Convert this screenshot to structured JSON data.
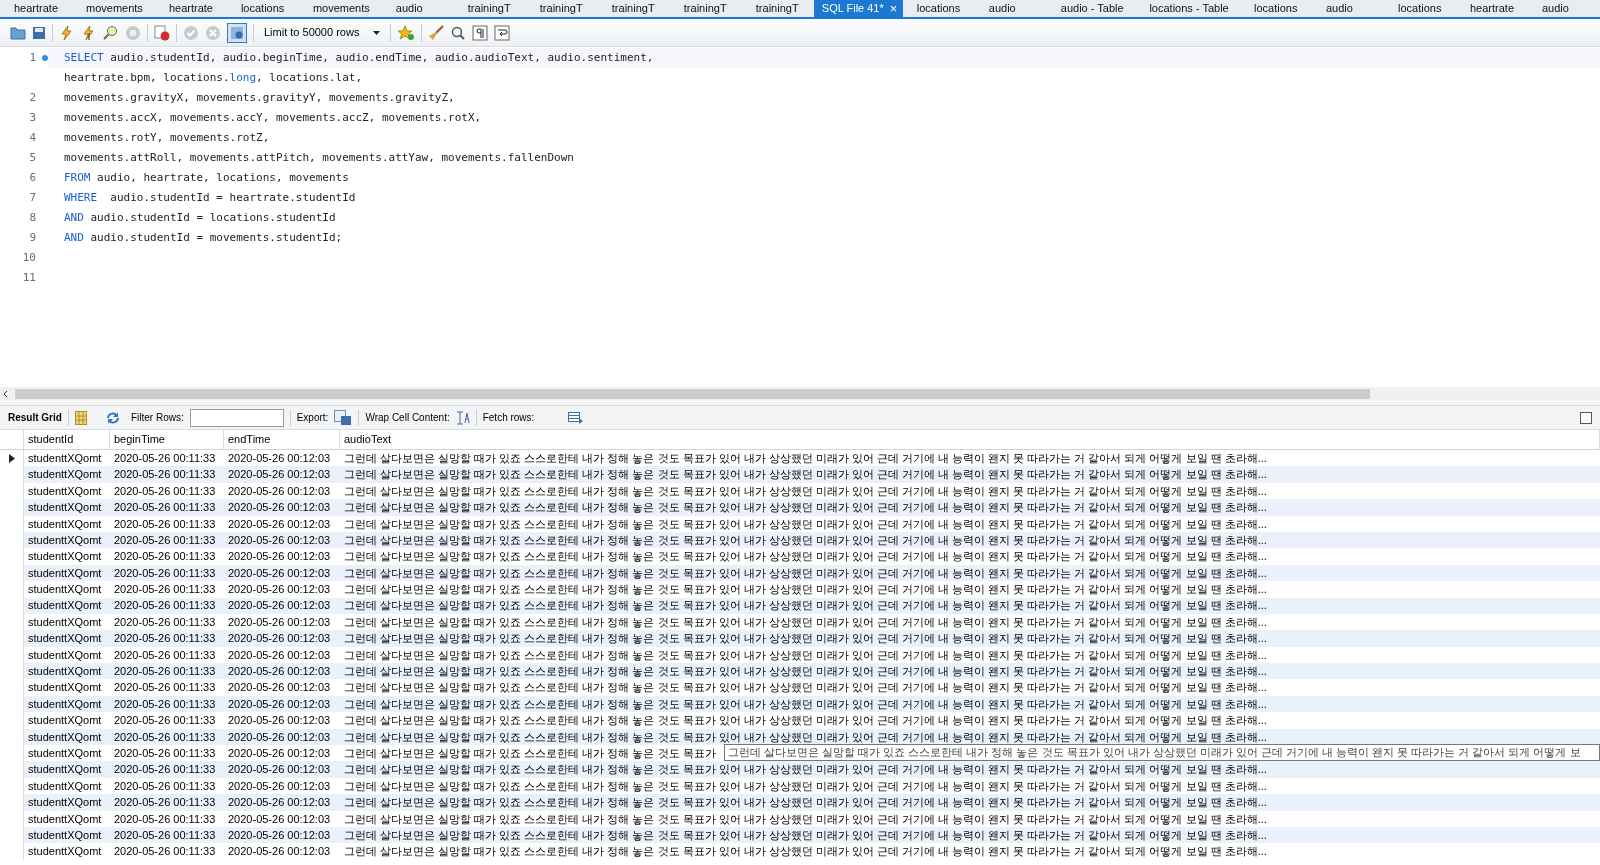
{
  "tabs": [
    {
      "label": "heartrate",
      "selected": false
    },
    {
      "label": "movements",
      "selected": false
    },
    {
      "label": "heartrate",
      "selected": false
    },
    {
      "label": "locations",
      "selected": false
    },
    {
      "label": "movements",
      "selected": false
    },
    {
      "label": "audio",
      "selected": false
    },
    {
      "label": "trainingT",
      "selected": false
    },
    {
      "label": "trainingT",
      "selected": false
    },
    {
      "label": "trainingT",
      "selected": false
    },
    {
      "label": "trainingT",
      "selected": false
    },
    {
      "label": "trainingT",
      "selected": false
    },
    {
      "label": "SQL File 41*",
      "selected": true,
      "close": "×"
    },
    {
      "label": "locations",
      "selected": false
    },
    {
      "label": "audio",
      "selected": false
    },
    {
      "label": "audio - Table",
      "selected": false
    },
    {
      "label": "locations - Table",
      "selected": false
    },
    {
      "label": "locations",
      "selected": false
    },
    {
      "label": "audio",
      "selected": false
    },
    {
      "label": "locations",
      "selected": false
    },
    {
      "label": "heartrate",
      "selected": false
    },
    {
      "label": "audio",
      "selected": false
    }
  ],
  "toolbar": {
    "limit": "Limit to 50000 rows"
  },
  "editor": {
    "lines": [
      {
        "number": "1",
        "marker": true,
        "segments": [
          {
            "kind": "keyword",
            "text": "SELECT"
          },
          {
            "kind": "plain",
            "text": " audio.studentId, audio.beginTime, audio.endTime, audio.audioText, audio.sentiment,"
          }
        ]
      },
      {
        "marker": false,
        "segments": [
          {
            "kind": "plain",
            "text": "heartrate.bpm, locations."
          },
          {
            "kind": "keyword",
            "text": "long"
          },
          {
            "kind": "plain",
            "text": ", locations.lat,"
          }
        ]
      },
      {
        "number": "2",
        "marker": false,
        "segments": [
          {
            "kind": "plain",
            "text": "movements.gravityX, movements.gravityY, movements.gravityZ,"
          }
        ]
      },
      {
        "number": "3",
        "marker": false,
        "segments": [
          {
            "kind": "plain",
            "text": "movements.accX, movements.accY, movements.accZ, movements.rotX,"
          }
        ]
      },
      {
        "number": "4",
        "marker": false,
        "segments": [
          {
            "kind": "plain",
            "text": "movements.rotY, movements.rotZ,"
          }
        ]
      },
      {
        "number": "5",
        "marker": false,
        "segments": [
          {
            "kind": "plain",
            "text": "movements.attRoll, movements.attPitch, movements.attYaw, movements.fallenDown"
          }
        ]
      },
      {
        "number": "6",
        "marker": false,
        "segments": [
          {
            "kind": "keyword",
            "text": "FROM"
          },
          {
            "kind": "plain",
            "text": " audio, heartrate, locations, movements"
          }
        ]
      },
      {
        "number": "7",
        "marker": false,
        "segments": [
          {
            "kind": "keyword",
            "text": "WHERE"
          },
          {
            "kind": "plain",
            "text": "  audio.studentId = heartrate.studentId"
          }
        ]
      },
      {
        "number": "8",
        "marker": false,
        "segments": [
          {
            "kind": "keyword",
            "text": "AND"
          },
          {
            "kind": "plain",
            "text": " audio.studentId = locations.studentId"
          }
        ]
      },
      {
        "number": "9",
        "marker": false,
        "segments": [
          {
            "kind": "keyword",
            "text": "AND"
          },
          {
            "kind": "plain",
            "text": " audio.studentId = movements.studentId;"
          }
        ]
      },
      {
        "number": "10",
        "marker": false
      },
      {
        "number": "11",
        "marker": false
      }
    ]
  },
  "result_toolbar": {
    "title": "Result Grid",
    "filter_label": "Filter Rows:",
    "export_label": "Export:",
    "wrap_label": "Wrap Cell Content:",
    "fetch_label": "Fetch rows:"
  },
  "table": {
    "columns": [
      "studentId",
      "beginTime",
      "endTime",
      "audioText"
    ],
    "rows": [
      {
        "selected": true,
        "cells": [
          "studenttXQomt",
          "2020-05-26 00:11:33",
          "2020-05-26 00:12:03",
          "그런데 살다보면은 실망할 때가 있죠 스스로한테 내가 정해 놓은 것도 목표가 있어 내가 상상했던 미래가 있어 근데 거기에 내 능력이 왠지 못 따라가는 거 같아서 되게 어떻게 보일 땐 초라해..."
        ]
      },
      {
        "selected": false,
        "cells": [
          "studenttXQomt",
          "2020-05-26 00:11:33",
          "2020-05-26 00:12:03",
          "그런데 살다보면은 실망할 때가 있죠 스스로한테 내가 정해 놓은 것도 목표가 있어 내가 상상했던 미래가 있어 근데 거기에 내 능력이 왠지 못 따라가는 거 같아서 되게 어떻게 보일 땐 초라해..."
        ]
      },
      {
        "selected": false,
        "cells": [
          "studenttXQomt",
          "2020-05-26 00:11:33",
          "2020-05-26 00:12:03",
          "그런데 살다보면은 실망할 때가 있죠 스스로한테 내가 정해 놓은 것도 목표가 있어 내가 상상했던 미래가 있어 근데 거기에 내 능력이 왠지 못 따라가는 거 같아서 되게 어떻게 보일 땐 초라해..."
        ]
      },
      {
        "selected": false,
        "cells": [
          "studenttXQomt",
          "2020-05-26 00:11:33",
          "2020-05-26 00:12:03",
          "그런데 살다보면은 실망할 때가 있죠 스스로한테 내가 정해 놓은 것도 목표가 있어 내가 상상했던 미래가 있어 근데 거기에 내 능력이 왠지 못 따라가는 거 같아서 되게 어떻게 보일 땐 초라해..."
        ]
      },
      {
        "selected": false,
        "cells": [
          "studenttXQomt",
          "2020-05-26 00:11:33",
          "2020-05-26 00:12:03",
          "그런데 살다보면은 실망할 때가 있죠 스스로한테 내가 정해 놓은 것도 목표가 있어 내가 상상했던 미래가 있어 근데 거기에 내 능력이 왠지 못 따라가는 거 같아서 되게 어떻게 보일 땐 초라해..."
        ]
      },
      {
        "selected": false,
        "cells": [
          "studenttXQomt",
          "2020-05-26 00:11:33",
          "2020-05-26 00:12:03",
          "그런데 살다보면은 실망할 때가 있죠 스스로한테 내가 정해 놓은 것도 목표가 있어 내가 상상했던 미래가 있어 근데 거기에 내 능력이 왠지 못 따라가는 거 같아서 되게 어떻게 보일 땐 초라해..."
        ]
      },
      {
        "selected": false,
        "cells": [
          "studenttXQomt",
          "2020-05-26 00:11:33",
          "2020-05-26 00:12:03",
          "그런데 살다보면은 실망할 때가 있죠 스스로한테 내가 정해 놓은 것도 목표가 있어 내가 상상했던 미래가 있어 근데 거기에 내 능력이 왠지 못 따라가는 거 같아서 되게 어떻게 보일 땐 초라해..."
        ]
      },
      {
        "selected": false,
        "cells": [
          "studenttXQomt",
          "2020-05-26 00:11:33",
          "2020-05-26 00:12:03",
          "그런데 살다보면은 실망할 때가 있죠 스스로한테 내가 정해 놓은 것도 목표가 있어 내가 상상했던 미래가 있어 근데 거기에 내 능력이 왠지 못 따라가는 거 같아서 되게 어떻게 보일 땐 초라해..."
        ]
      },
      {
        "selected": false,
        "cells": [
          "studenttXQomt",
          "2020-05-26 00:11:33",
          "2020-05-26 00:12:03",
          "그런데 살다보면은 실망할 때가 있죠 스스로한테 내가 정해 놓은 것도 목표가 있어 내가 상상했던 미래가 있어 근데 거기에 내 능력이 왠지 못 따라가는 거 같아서 되게 어떻게 보일 땐 초라해..."
        ]
      },
      {
        "selected": false,
        "cells": [
          "studenttXQomt",
          "2020-05-26 00:11:33",
          "2020-05-26 00:12:03",
          "그런데 살다보면은 실망할 때가 있죠 스스로한테 내가 정해 놓은 것도 목표가 있어 내가 상상했던 미래가 있어 근데 거기에 내 능력이 왠지 못 따라가는 거 같아서 되게 어떻게 보일 땐 초라해..."
        ]
      },
      {
        "selected": false,
        "cells": [
          "studenttXQomt",
          "2020-05-26 00:11:33",
          "2020-05-26 00:12:03",
          "그런데 살다보면은 실망할 때가 있죠 스스로한테 내가 정해 놓은 것도 목표가 있어 내가 상상했던 미래가 있어 근데 거기에 내 능력이 왠지 못 따라가는 거 같아서 되게 어떻게 보일 땐 초라해..."
        ]
      },
      {
        "selected": false,
        "cells": [
          "studenttXQomt",
          "2020-05-26 00:11:33",
          "2020-05-26 00:12:03",
          "그런데 살다보면은 실망할 때가 있죠 스스로한테 내가 정해 놓은 것도 목표가 있어 내가 상상했던 미래가 있어 근데 거기에 내 능력이 왠지 못 따라가는 거 같아서 되게 어떻게 보일 땐 초라해..."
        ]
      },
      {
        "selected": false,
        "cells": [
          "studenttXQomt",
          "2020-05-26 00:11:33",
          "2020-05-26 00:12:03",
          "그런데 살다보면은 실망할 때가 있죠 스스로한테 내가 정해 놓은 것도 목표가 있어 내가 상상했던 미래가 있어 근데 거기에 내 능력이 왠지 못 따라가는 거 같아서 되게 어떻게 보일 땐 초라해..."
        ]
      },
      {
        "selected": false,
        "cells": [
          "studenttXQomt",
          "2020-05-26 00:11:33",
          "2020-05-26 00:12:03",
          "그런데 살다보면은 실망할 때가 있죠 스스로한테 내가 정해 놓은 것도 목표가 있어 내가 상상했던 미래가 있어 근데 거기에 내 능력이 왠지 못 따라가는 거 같아서 되게 어떻게 보일 땐 초라해..."
        ]
      },
      {
        "selected": false,
        "cells": [
          "studenttXQomt",
          "2020-05-26 00:11:33",
          "2020-05-26 00:12:03",
          "그런데 살다보면은 실망할 때가 있죠 스스로한테 내가 정해 놓은 것도 목표가 있어 내가 상상했던 미래가 있어 근데 거기에 내 능력이 왠지 못 따라가는 거 같아서 되게 어떻게 보일 땐 초라해..."
        ]
      },
      {
        "selected": false,
        "cells": [
          "studenttXQomt",
          "2020-05-26 00:11:33",
          "2020-05-26 00:12:03",
          "그런데 살다보면은 실망할 때가 있죠 스스로한테 내가 정해 놓은 것도 목표가 있어 내가 상상했던 미래가 있어 근데 거기에 내 능력이 왠지 못 따라가는 거 같아서 되게 어떻게 보일 땐 초라해..."
        ]
      },
      {
        "selected": false,
        "cells": [
          "studenttXQomt",
          "2020-05-26 00:11:33",
          "2020-05-26 00:12:03",
          "그런데 살다보면은 실망할 때가 있죠 스스로한테 내가 정해 놓은 것도 목표가 있어 내가 상상했던 미래가 있어 근데 거기에 내 능력이 왠지 못 따라가는 거 같아서 되게 어떻게 보일 땐 초라해..."
        ]
      },
      {
        "selected": false,
        "cells": [
          "studenttXQomt",
          "2020-05-26 00:11:33",
          "2020-05-26 00:12:03",
          "그런데 살다보면은 실망할 때가 있죠 스스로한테 내가 정해 놓은 것도 목표가 있어 내가 상상했던 미래가 있어 근데 거기에 내 능력이 왠지 못 따라가는 거 같아서 되게 어떻게 보일 땐 초라해..."
        ]
      },
      {
        "selected": false,
        "cells": [
          "studenttXQomt",
          "2020-05-26 00:11:33",
          "2020-05-26 00:12:03",
          "그런데 살다보면은 실망할 때가 있죠 스스로한테 내가 정해 놓은 것도 목표가"
        ]
      },
      {
        "selected": false,
        "cells": [
          "studenttXQomt",
          "2020-05-26 00:11:33",
          "2020-05-26 00:12:03",
          "그런데 살다보면은 실망할 때가 있죠 스스로한테 내가 정해 놓은 것도 목표가 있어 내가 상상했던 미래가 있어 근데 거기에 내 능력이 왠지 못 따라가는 거 같아서 되게 어떻게 보일 땐 초라해..."
        ]
      },
      {
        "selected": false,
        "cells": [
          "studenttXQomt",
          "2020-05-26 00:11:33",
          "2020-05-26 00:12:03",
          "그런데 살다보면은 실망할 때가 있죠 스스로한테 내가 정해 놓은 것도 목표가 있어 내가 상상했던 미래가 있어 근데 거기에 내 능력이 왠지 못 따라가는 거 같아서 되게 어떻게 보일 땐 초라해..."
        ]
      },
      {
        "selected": false,
        "cells": [
          "studenttXQomt",
          "2020-05-26 00:11:33",
          "2020-05-26 00:12:03",
          "그런데 살다보면은 실망할 때가 있죠 스스로한테 내가 정해 놓은 것도 목표가 있어 내가 상상했던 미래가 있어 근데 거기에 내 능력이 왠지 못 따라가는 거 같아서 되게 어떻게 보일 땐 초라해..."
        ]
      },
      {
        "selected": false,
        "cells": [
          "studenttXQomt",
          "2020-05-26 00:11:33",
          "2020-05-26 00:12:03",
          "그런데 살다보면은 실망할 때가 있죠 스스로한테 내가 정해 놓은 것도 목표가 있어 내가 상상했던 미래가 있어 근데 거기에 내 능력이 왠지 못 따라가는 거 같아서 되게 어떻게 보일 땐 초라해..."
        ]
      },
      {
        "selected": false,
        "cells": [
          "studenttXQomt",
          "2020-05-26 00:11:33",
          "2020-05-26 00:12:03",
          "그런데 살다보면은 실망할 때가 있죠 스스로한테 내가 정해 놓은 것도 목표가 있어 내가 상상했던 미래가 있어 근데 거기에 내 능력이 왠지 못 따라가는 거 같아서 되게 어떻게 보일 땐 초라해..."
        ]
      },
      {
        "selected": false,
        "cells": [
          "studenttXQomt",
          "2020-05-26 00:11:33",
          "2020-05-26 00:12:03",
          "그런데 살다보면은 실망할 때가 있죠 스스로한테 내가 정해 놓은 것도 목표가 있어 내가 상상했던 미래가 있어 근데 거기에 내 능력이 왠지 못 따라가는 거 같아서 되게 어떻게 보일 땐 초라해..."
        ]
      }
    ]
  },
  "tooltip": {
    "text": "그런데 살다보면은 실망할 때가 있죠 스스로한테 내가 정해 놓은 것도 목표가 있어 내가 상상했던 미래가 있어 근데 거기에 내 능력이 왠지 못 따라가는 거 같아서 되게 어떻게 보"
  }
}
